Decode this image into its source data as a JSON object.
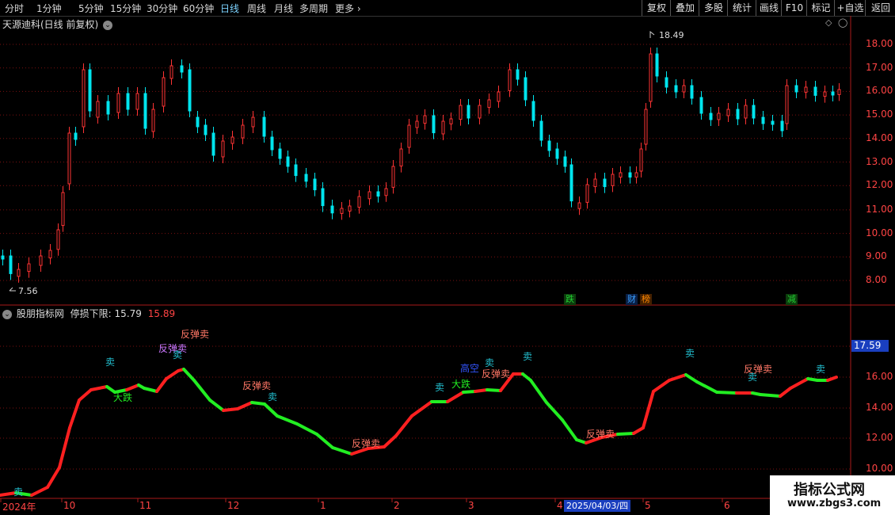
{
  "toolbar": {
    "timeframes": [
      {
        "label": "分时",
        "active": false
      },
      {
        "label": "1分钟",
        "active": false
      },
      {
        "label": "5分钟",
        "active": false
      },
      {
        "label": "15分钟",
        "active": false
      },
      {
        "label": "30分钟",
        "active": false
      },
      {
        "label": "60分钟",
        "active": false
      },
      {
        "label": "日线",
        "active": true
      },
      {
        "label": "周线",
        "active": false
      },
      {
        "label": "月线",
        "active": false
      },
      {
        "label": "多周期",
        "active": false
      },
      {
        "label": "更多 ›",
        "active": false
      }
    ],
    "buttons": [
      "复权",
      "叠加",
      "多股",
      "统计",
      "画线",
      "F10",
      "标记",
      "+自选",
      "返回"
    ]
  },
  "main_chart": {
    "title": "天源迪科(日线 前复权)",
    "y_ticks": [
      "18.00",
      "17.00",
      "16.00",
      "15.00",
      "14.00",
      "13.00",
      "12.00",
      "11.00",
      "10.00",
      "9.00",
      "8.00"
    ],
    "high_label": "18.49",
    "low_label": "7.56",
    "event_badges": [
      {
        "text": "跌",
        "color": "#22cc33"
      },
      {
        "text": "财",
        "color": "#3aa0ff"
      },
      {
        "text": "榜",
        "color": "#ff8800"
      },
      {
        "text": "减",
        "color": "#22cc33"
      }
    ]
  },
  "indicator": {
    "name": "股朋指标网",
    "stop_label": "停损下限:",
    "value_white": "15.79",
    "value_red": "15.89",
    "y_ticks": [
      "16.00",
      "14.00",
      "12.00",
      "10.00"
    ],
    "current_value": "17.59",
    "signals": [
      {
        "text": "卖",
        "color": "#22c0d0"
      },
      {
        "text": "卖",
        "color": "#22c0d0"
      },
      {
        "text": "大跌",
        "color": "#22ee22"
      },
      {
        "text": "反弹卖",
        "color": "#cc77ff"
      },
      {
        "text": "卖",
        "color": "#22c0d0"
      },
      {
        "text": "反弹卖",
        "color": "#ff7766"
      },
      {
        "text": "反弹卖",
        "color": "#ff7766"
      },
      {
        "text": "卖",
        "color": "#22c0d0"
      },
      {
        "text": "反弹卖",
        "color": "#ff7766"
      },
      {
        "text": "卖",
        "color": "#22c0d0"
      },
      {
        "text": "高空",
        "color": "#3355ff"
      },
      {
        "text": "卖",
        "color": "#22c0d0"
      },
      {
        "text": "大跌",
        "color": "#22ee22"
      },
      {
        "text": "反弹卖",
        "color": "#ff7766"
      },
      {
        "text": "卖",
        "color": "#22c0d0"
      },
      {
        "text": "反弹卖",
        "color": "#ff7766"
      },
      {
        "text": "卖",
        "color": "#22c0d0"
      },
      {
        "text": "卖",
        "color": "#22c0d0"
      },
      {
        "text": "反弹卖",
        "color": "#ff7766"
      },
      {
        "text": "卖",
        "color": "#22c0d0"
      }
    ]
  },
  "x_axis": {
    "labels": [
      "2024年",
      "10",
      "11",
      "12",
      "1",
      "2",
      "3",
      "4",
      "5",
      "6"
    ],
    "cursor_date": "2025/04/03/四"
  },
  "watermark": {
    "title": "指标公式网",
    "url": "www.zbgs3.com"
  },
  "colors": {
    "up": "#ff3333",
    "down": "#00e5ee",
    "grid": "#8a1010",
    "line_up": "#ff2020",
    "line_down": "#22ee22"
  }
}
